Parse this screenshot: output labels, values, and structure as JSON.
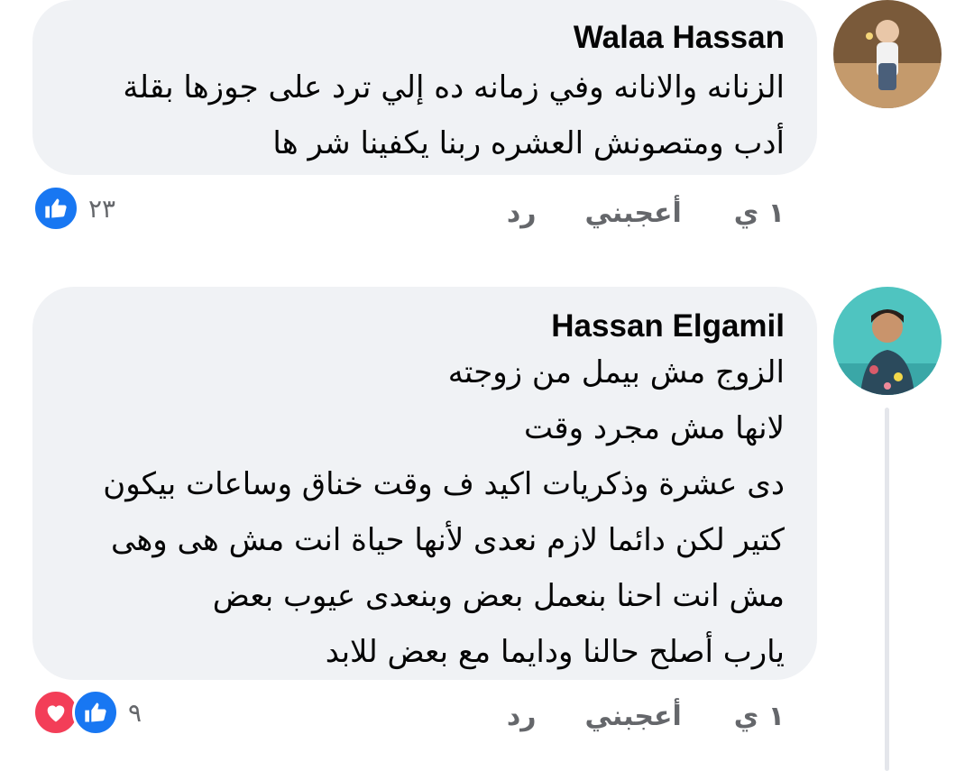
{
  "comments": [
    {
      "author": "Walaa Hassan",
      "lines": [
        "الزنانه والانانه وفي زمانه ده إلي ترد على جوزها بقلة",
        "أدب ومتصونش العشره ربنا يكفينا شر ها"
      ],
      "time": "١ ي",
      "like_label": "أعجبني",
      "reply_label": "رد",
      "reaction_count": "٢٣",
      "reactions": [
        "like-icon"
      ]
    },
    {
      "author": "Hassan Elgamil",
      "lines": [
        "الزوج مش بيمل من زوجته",
        "لانها مش مجرد وقت",
        "دى عشرة وذكريات اكيد ف وقت خناق وساعات بيكون",
        "كتير لكن دائما لازم نعدى لأنها حياة انت مش هى وهى",
        "مش انت احنا بنعمل بعض وبنعدى عيوب بعض",
        "يارب أصلح حالنا ودايما مع بعض للابد"
      ],
      "time": "١ ي",
      "like_label": "أعجبني",
      "reply_label": "رد",
      "reaction_count": "٩",
      "reactions": [
        "heart-icon",
        "like-icon"
      ]
    }
  ],
  "colors": {
    "bubble": "#f0f2f5",
    "like": "#1877f2",
    "love": "#f33e58",
    "meta_text": "#65676b"
  }
}
